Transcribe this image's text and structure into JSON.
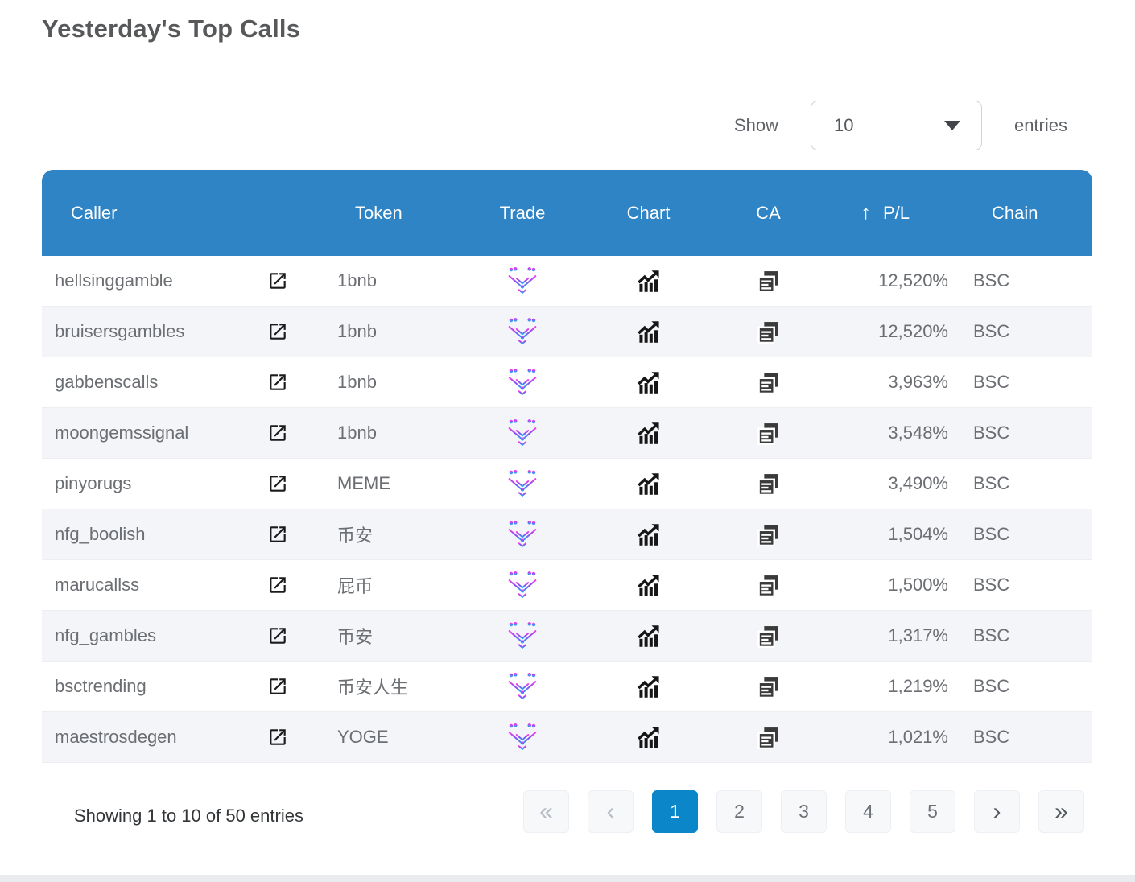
{
  "page": {
    "title": "Yesterday's Top Calls"
  },
  "length_control": {
    "show_label": "Show",
    "entries_label": "entries",
    "selected": "10"
  },
  "table": {
    "headers": {
      "caller": "Caller",
      "token": "Token",
      "trade": "Trade",
      "chart": "Chart",
      "ca": "CA",
      "pl": "P/L",
      "chain": "Chain"
    },
    "sort": {
      "column": "P/L",
      "direction": "ascending",
      "icon": "↑"
    },
    "icons": {
      "link": "external-link-icon",
      "trade": "maestro-bot-icon",
      "chart": "trending-chart-icon",
      "ca": "copy-contract-icon"
    },
    "rows": [
      {
        "caller": "hellsinggamble",
        "token": "1bnb",
        "pl": "12,520%",
        "chain": "BSC"
      },
      {
        "caller": "bruisersgambles",
        "token": "1bnb",
        "pl": "12,520%",
        "chain": "BSC"
      },
      {
        "caller": "gabbenscalls",
        "token": "1bnb",
        "pl": "3,963%",
        "chain": "BSC"
      },
      {
        "caller": "moongemssignal",
        "token": "1bnb",
        "pl": "3,548%",
        "chain": "BSC"
      },
      {
        "caller": "pinyorugs",
        "token": "MEME",
        "pl": "3,490%",
        "chain": "BSC"
      },
      {
        "caller": "nfg_boolish",
        "token": "币安",
        "pl": "1,504%",
        "chain": "BSC"
      },
      {
        "caller": "marucallss",
        "token": "屁币",
        "pl": "1,500%",
        "chain": "BSC"
      },
      {
        "caller": "nfg_gambles",
        "token": "币安",
        "pl": "1,317%",
        "chain": "BSC"
      },
      {
        "caller": "bsctrending",
        "token": "币安人生",
        "pl": "1,219%",
        "chain": "BSC"
      },
      {
        "caller": "maestrosdegen",
        "token": "YOGE",
        "pl": "1,021%",
        "chain": "BSC"
      }
    ]
  },
  "pagination": {
    "summary": "Showing 1 to 10 of 50 entries",
    "first": "«",
    "prev": "‹",
    "pages": [
      "1",
      "2",
      "3",
      "4",
      "5"
    ],
    "active_page": "1",
    "next": "›",
    "last": "»"
  },
  "colors": {
    "header_bg": "#2e84c4",
    "active_page_bg": "#0b87c9",
    "alt_row_bg": "#f4f5f8",
    "body_text": "#6b6e72",
    "title_text": "#56585a"
  }
}
